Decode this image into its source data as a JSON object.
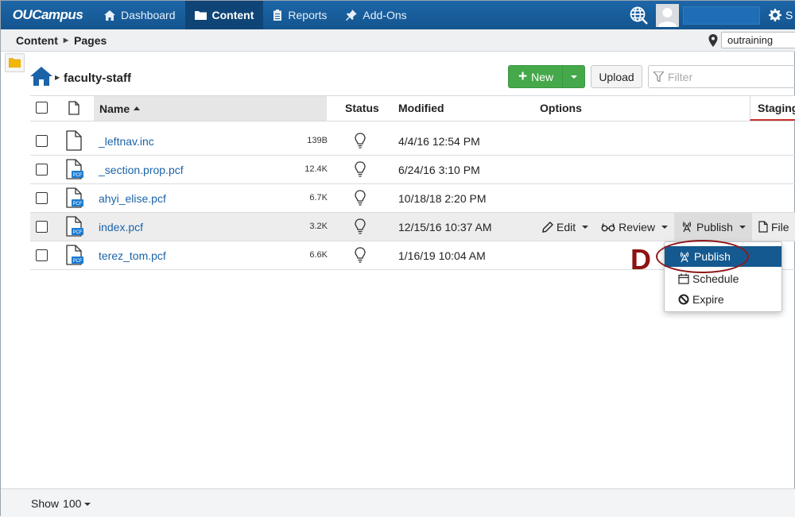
{
  "app": {
    "logo_text": "OUCampus",
    "nav": [
      {
        "label": "Dashboard",
        "icon": "home-icon"
      },
      {
        "label": "Content",
        "icon": "folder-icon",
        "active": true
      },
      {
        "label": "Reports",
        "icon": "clipboard-icon"
      },
      {
        "label": "Add-Ons",
        "icon": "pin-icon"
      }
    ],
    "settings_label": "S",
    "colors": {
      "nav_bg": "#14558f",
      "accent_green": "#45a84a",
      "link": "#1b63a8",
      "annotation": "#8e1a1a"
    }
  },
  "breadcrumb": {
    "items": [
      "Content",
      "Pages"
    ]
  },
  "site": {
    "value": "outraining"
  },
  "path": {
    "title": "faculty-staff"
  },
  "toolbar": {
    "new_label": "New",
    "upload_label": "Upload",
    "filter_placeholder": "Filter"
  },
  "table": {
    "headers": {
      "name": "Name",
      "status": "Status",
      "modified": "Modified",
      "options": "Options",
      "staging": "Staging"
    },
    "rows": [
      {
        "name": "_leftnav.inc",
        "size": "139B",
        "modified": "4/4/16 12:54 PM",
        "pcf": false
      },
      {
        "name": "_section.prop.pcf",
        "size": "12.4K",
        "modified": "6/24/16 3:10 PM",
        "pcf": true
      },
      {
        "name": "ahyi_elise.pcf",
        "size": "6.7K",
        "modified": "10/18/18 2:20 PM",
        "pcf": true
      },
      {
        "name": "index.pcf",
        "size": "3.2K",
        "modified": "12/15/16 10:37 AM",
        "pcf": true
      },
      {
        "name": "terez_tom.pcf",
        "size": "6.6K",
        "modified": "1/16/19 10:04 AM",
        "pcf": true
      }
    ],
    "pcf_label": "PCF"
  },
  "row_options": {
    "edit": "Edit",
    "review": "Review",
    "publish": "Publish",
    "file": "File"
  },
  "publish_menu": {
    "items": [
      "Publish",
      "Schedule",
      "Expire"
    ]
  },
  "annotation": {
    "letter": "D"
  },
  "footer": {
    "show_label": "Show",
    "show_value": "100"
  }
}
